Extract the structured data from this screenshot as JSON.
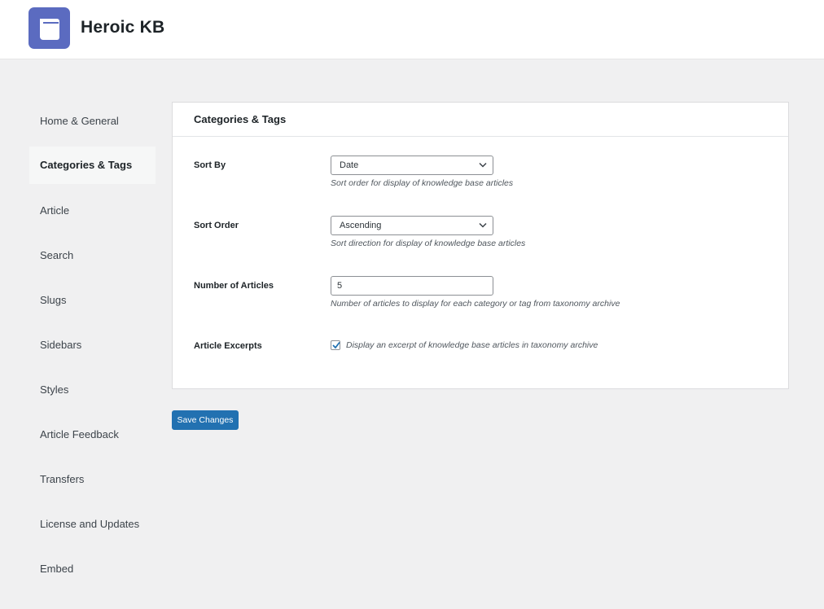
{
  "header": {
    "brand": "Heroic KB",
    "logo_color": "#5b6bc0"
  },
  "sidebar": {
    "items": [
      {
        "label": "Home & General",
        "active": false
      },
      {
        "label": "Categories & Tags",
        "active": true
      },
      {
        "label": "Article",
        "active": false
      },
      {
        "label": "Search",
        "active": false
      },
      {
        "label": "Slugs",
        "active": false
      },
      {
        "label": "Sidebars",
        "active": false
      },
      {
        "label": "Styles",
        "active": false
      },
      {
        "label": "Article Feedback",
        "active": false
      },
      {
        "label": "Transfers",
        "active": false
      },
      {
        "label": "License and Updates",
        "active": false
      },
      {
        "label": "Embed",
        "active": false
      }
    ]
  },
  "panel": {
    "title": "Categories & Tags",
    "sort_by": {
      "label": "Sort By",
      "value": "Date",
      "description": "Sort order for display of knowledge base articles"
    },
    "sort_order": {
      "label": "Sort Order",
      "value": "Ascending",
      "description": "Sort direction for display of knowledge base articles"
    },
    "number_of_articles": {
      "label": "Number of Articles",
      "value": "5",
      "description": "Number of articles to display for each category or tag from taxonomy archive"
    },
    "article_excerpts": {
      "label": "Article Excerpts",
      "checked": true,
      "description": "Display an excerpt of knowledge base articles in taxonomy archive"
    }
  },
  "actions": {
    "save_label": "Save Changes",
    "accent_color": "#2271b1"
  }
}
